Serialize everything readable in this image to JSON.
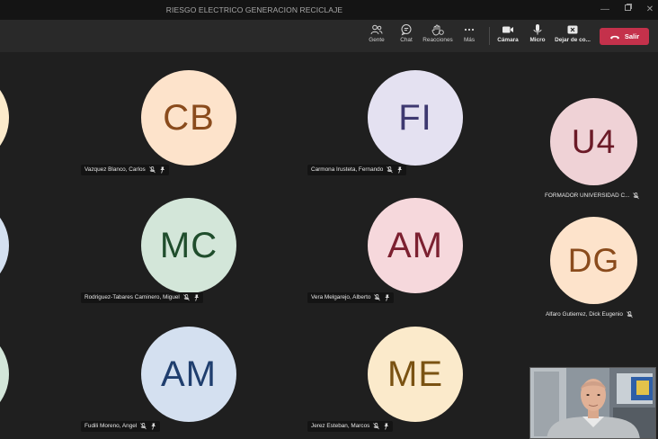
{
  "window": {
    "title": "RIESGO ELECTRICO GENERACION RECICLAJE"
  },
  "toolbar": {
    "people_label": "Gente",
    "chat_label": "Chat",
    "reactions_label": "Reacciones",
    "more_label": "Más",
    "camera_label": "Cámara",
    "mic_label": "Micro",
    "stop_share_label": "Dejar de co...",
    "leave_label": "Salir"
  },
  "participants": [
    {
      "initials": "CB",
      "name": "Vazquez Blanco, Carlos",
      "bg": "#fde3cb",
      "fg": "#8a4b1c"
    },
    {
      "initials": "FI",
      "name": "Carmona Irusteta, Fernando",
      "bg": "#e4e1f1",
      "fg": "#3d3870"
    },
    {
      "initials": "U4",
      "name": "FORMADOR UNIVERSIDAD C...",
      "bg": "#efd2d6",
      "fg": "#6b1a27"
    },
    {
      "initials": "MC",
      "name": "Rodriguez-Tabares Caminero, Miguel",
      "bg": "#d3e6d9",
      "fg": "#1f4d2c"
    },
    {
      "initials": "AM",
      "name": "Vera Melgarejo, Alberto",
      "bg": "#f6d8dc",
      "fg": "#7c2030"
    },
    {
      "initials": "DG",
      "name": "Alfaro Gutierrez, Dick Eugenio",
      "bg": "#fde3cb",
      "fg": "#8a4b1c"
    },
    {
      "initials": "AM",
      "name": "Fudili Moreno, Angel",
      "bg": "#d4e0f0",
      "fg": "#1f3e6e"
    },
    {
      "initials": "ME",
      "name": "Jerez Esteban, Marcos",
      "bg": "#fbeacb",
      "fg": "#7a5212"
    }
  ],
  "colors": {
    "leave": "#c4314b",
    "background": "#1f1f1f",
    "toolbar": "#292929"
  }
}
